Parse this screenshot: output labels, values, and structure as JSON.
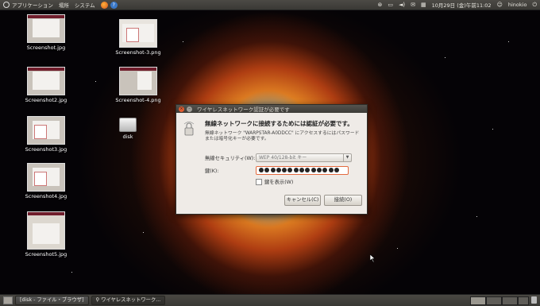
{
  "top_panel": {
    "menus": [
      "アプリケーション",
      "場所",
      "システム"
    ],
    "clock": "10月29日 (金)午前11:02",
    "user": "hinokio"
  },
  "desktop_icons": [
    {
      "label": "Screenshot.jpg"
    },
    {
      "label": "Screenshot-3.png"
    },
    {
      "label": "Screenshot2.jpg"
    },
    {
      "label": "Screenshot-4.png"
    },
    {
      "label": "Screenshot3.jpg"
    },
    {
      "label": "disk"
    },
    {
      "label": "Screenshot4.jpg"
    },
    {
      "label": "Screenshot5.jpg"
    }
  ],
  "dialog": {
    "title": "ワイヤレスネットワーク認証が必要です",
    "heading": "無線ネットワークに接続するためには認証が必要です。",
    "description": "無線ネットワーク \"WARPSTAR-A0DDCC\" にアクセスするにはパスワードまたは暗号化キーが必要です。",
    "security_label": "無線セキュリティ(W):",
    "security_value": "WEP 40/128-bit キー",
    "key_label": "鍵(K):",
    "show_key_label": "鍵を表示(W)",
    "cancel_label": "キャンセル(C)",
    "connect_label": "接続(O)"
  },
  "taskbar": {
    "tasks": [
      "[disk - ファイル・ブラウザ]",
      "ワイヤレスネットワーク..."
    ]
  },
  "colors": {
    "accent": "#e25c30",
    "panel": "#3c3b37"
  }
}
